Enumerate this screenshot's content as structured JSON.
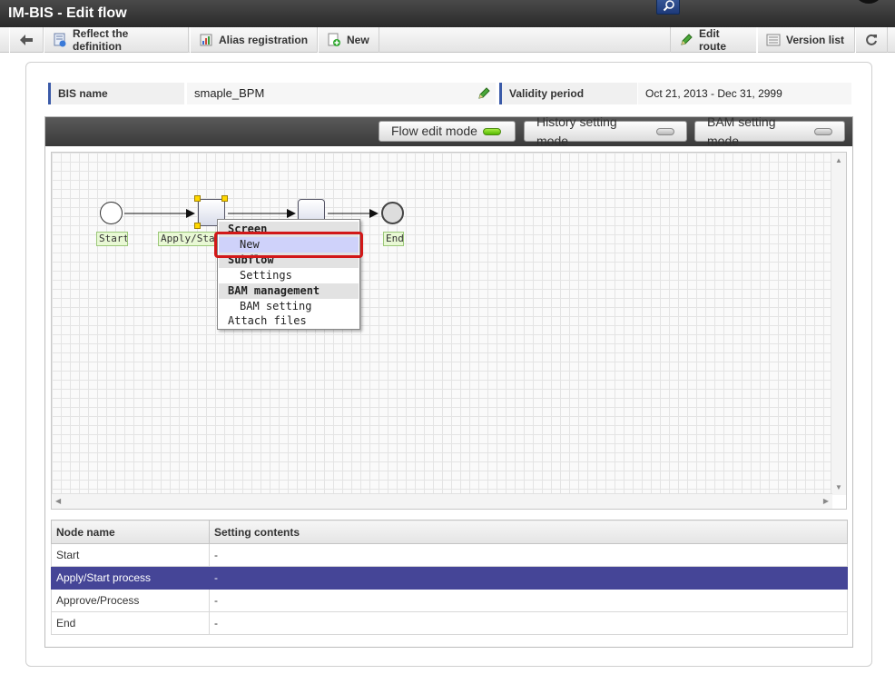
{
  "window": {
    "title": "IM-BIS - Edit flow"
  },
  "toolbar": {
    "back_label": "",
    "reflect_label": "Reflect the definition",
    "alias_label": "Alias registration",
    "new_label": "New",
    "edit_route_label": "Edit route",
    "version_list_label": "Version list"
  },
  "info": {
    "bis_name_label": "BIS name",
    "bis_name_value": "smaple_BPM",
    "validity_label": "Validity period",
    "validity_value": "Oct 21, 2013  -  Dec 31, 2999"
  },
  "modes": {
    "flow_edit": "Flow edit mode",
    "history_setting": "History setting mode",
    "bam_setting": "BAM setting mode",
    "active": "flow_edit"
  },
  "flow": {
    "nodes": {
      "start": "Start",
      "apply_start": "Apply/Start",
      "end": "End"
    }
  },
  "context_menu": {
    "items": [
      {
        "label": "Screen",
        "kind": "head"
      },
      {
        "label": "New",
        "kind": "sub",
        "highlighted": true
      },
      {
        "label": "Subflow",
        "kind": "head"
      },
      {
        "label": "Settings",
        "kind": "sub"
      },
      {
        "label": "BAM management",
        "kind": "head"
      },
      {
        "label": "BAM setting",
        "kind": "sub"
      },
      {
        "label": "Attach files",
        "kind": "item"
      }
    ]
  },
  "table": {
    "headers": [
      "Node name",
      "Setting contents"
    ],
    "rows": [
      {
        "name": "Start",
        "content": "-"
      },
      {
        "name": "Apply/Start process",
        "content": "-",
        "selected": true
      },
      {
        "name": "Approve/Process",
        "content": "-"
      },
      {
        "name": "End",
        "content": "-"
      }
    ]
  },
  "colors": {
    "selected_row": "#454597",
    "highlight_border": "#d21818",
    "active_led": "#54b800"
  }
}
